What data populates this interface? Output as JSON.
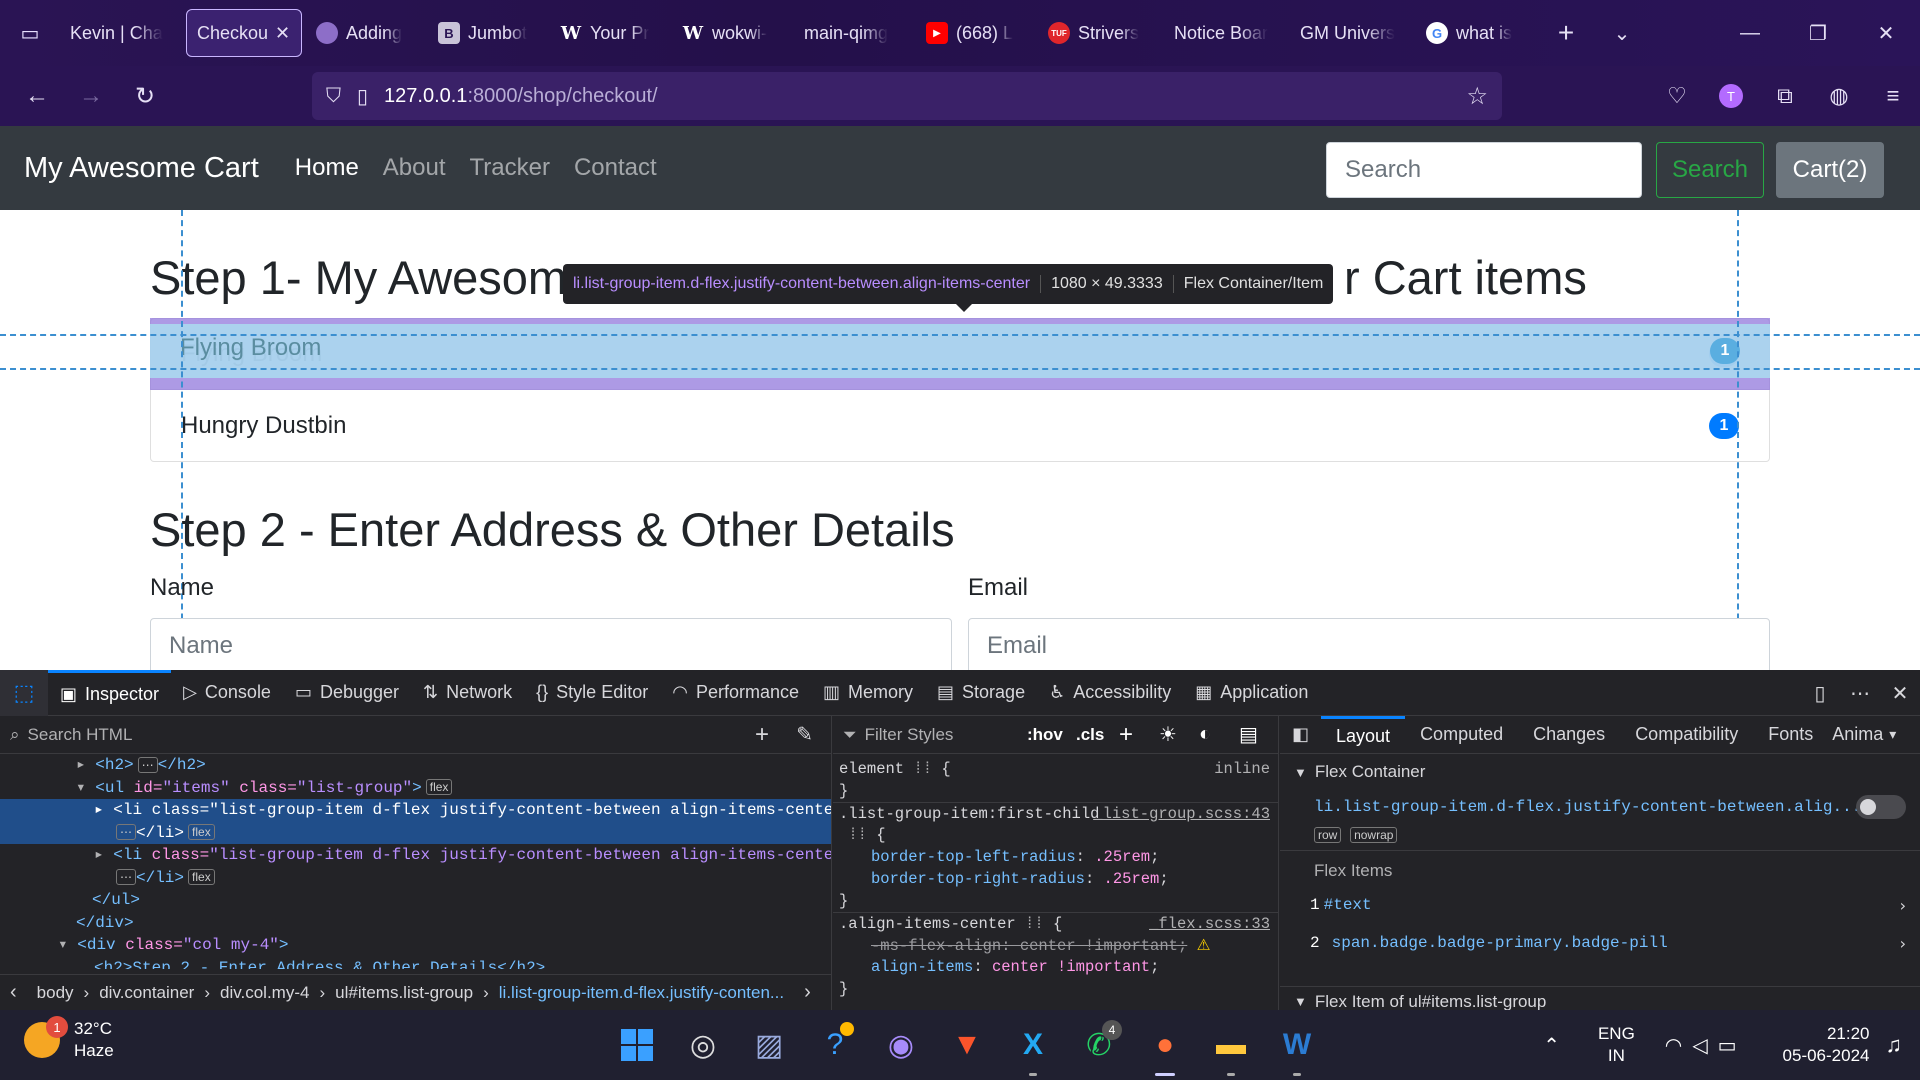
{
  "browser": {
    "tabs": [
      {
        "title": "Kevin | Cha",
        "favicon": "none",
        "active": false
      },
      {
        "title": "Checkou",
        "favicon": "none",
        "active": true
      },
      {
        "title": "Adding",
        "favicon": "avatar-icon",
        "active": false
      },
      {
        "title": "Jumbot",
        "favicon": "bootstrap-icon",
        "active": false
      },
      {
        "title": "Your Pr",
        "favicon": "w-icon",
        "active": false
      },
      {
        "title": "wokwi-",
        "favicon": "w-icon",
        "active": false
      },
      {
        "title": "main-qimg",
        "favicon": "none",
        "active": false
      },
      {
        "title": "(668) L",
        "favicon": "youtube-icon",
        "active": false
      },
      {
        "title": "Strivers",
        "favicon": "tuf-icon",
        "active": false
      },
      {
        "title": "Notice Boar",
        "favicon": "none",
        "active": false
      },
      {
        "title": "GM Univers",
        "favicon": "none",
        "active": false
      },
      {
        "title": "what is",
        "favicon": "google-icon",
        "active": false
      }
    ],
    "url_host": "127.0.0.1",
    "url_path": ":8000/shop/checkout/",
    "profile_initial": "T",
    "favicon_labels": {
      "bootstrap": "B",
      "w": "W",
      "tuf": "TUF",
      "google": "G"
    }
  },
  "site": {
    "brand": "My Awesome Cart",
    "nav": [
      "Home",
      "About",
      "Tracker",
      "Contact"
    ],
    "search_placeholder": "Search",
    "search_button": "Search",
    "cart_button": "Cart(2)",
    "step1_heading_start": "Step 1- My Awesom",
    "step1_heading_end": "r Cart items",
    "items": [
      {
        "name": "Flying Broom",
        "qty": "1"
      },
      {
        "name": "Hungry Dustbin",
        "qty": "1"
      }
    ],
    "step2_heading": "Step 2 - Enter Address & Other Details",
    "name_label": "Name",
    "name_placeholder": "Name",
    "email_label": "Email",
    "email_placeholder": "Email"
  },
  "highlighter": {
    "selector": "li.list-group-item.d-flex.justify-content-between.align-items-center",
    "dimensions": "1080 × 49.3333",
    "kind": "Flex Container/Item"
  },
  "devtools": {
    "tabs": [
      "Inspector",
      "Console",
      "Debugger",
      "Network",
      "Style Editor",
      "Performance",
      "Memory",
      "Storage",
      "Accessibility",
      "Application"
    ],
    "search_html": "Search HTML",
    "filter_styles": "Filter Styles",
    "hov": ":hov",
    "cls": ".cls",
    "html_lines": {
      "l1_tag": "<h2>",
      "l1_end": "</h2>",
      "l2_open": "<ul ",
      "l2_id_attr": "id=",
      "l2_id_val": "\"items\"",
      "l2_class_attr": " class=",
      "l2_class_val": "\"list-group\"",
      "l2_close": ">",
      "li_open": "<li ",
      "li_class_attr": "class=",
      "li_class_val": "\"list-group-item d-flex justify-content-between align-items-center\"",
      "li_close": ">",
      "li_end": "</li>",
      "ul_end": "</ul>",
      "div_end": "</div>",
      "div_open": "<div ",
      "div_class_attr": "class=",
      "div_class_val": "\"col my-4\"",
      "div_close": ">",
      "h2_partial": "<h2>Step 2 - Enter Address & Other Details</h2>",
      "flex_pill": "flex",
      "ellipsis": "⋯"
    },
    "breadcrumbs": [
      "body",
      "div.container",
      "div.col.my-4",
      "ul#items.list-group",
      "li.list-group-item.d-flex.justify-conten..."
    ],
    "css": {
      "element_selector": "element",
      "element_open": "{",
      "element_type": "inline",
      "close_brace": "}",
      "rule1_selector": ".list-group-item:first-child",
      "rule1_src": "_list-group.scss:43",
      "rule1_p1": "border-top-left-radius",
      "rule1_v1": ".25rem",
      "rule1_p2": "border-top-right-radius",
      "rule1_v2": ".25rem",
      "rule2_selector": ".align-items-center",
      "rule2_src": "_flex.scss:33",
      "rule2_strike": "-ms-flex-align: center !important;",
      "rule2_p1": "align-items",
      "rule2_v1": "center !important"
    },
    "layout_tabs": [
      "Layout",
      "Computed",
      "Changes",
      "Compatibility",
      "Fonts",
      "Anima"
    ],
    "flex_container_title": "Flex Container",
    "flex_container_selector": "li.list-group-item.d-flex.justify-content-between.alig...",
    "flex_props": [
      "row",
      "nowrap"
    ],
    "flex_items_title": "Flex Items",
    "flex_items": [
      {
        "index": "1",
        "name": "#text"
      },
      {
        "index": "2",
        "name": "span.badge.badge-primary.badge-pill"
      }
    ],
    "flex_item_of": "Flex Item of ul#items.list-group"
  },
  "taskbar": {
    "weather_temp": "32°C",
    "weather_desc": "Haze",
    "weather_badge": "1",
    "whatsapp_count": "4",
    "lang_top": "ENG",
    "lang_bottom": "IN",
    "time": "21:20",
    "date": "05-06-2024",
    "vscode_label": "X"
  }
}
